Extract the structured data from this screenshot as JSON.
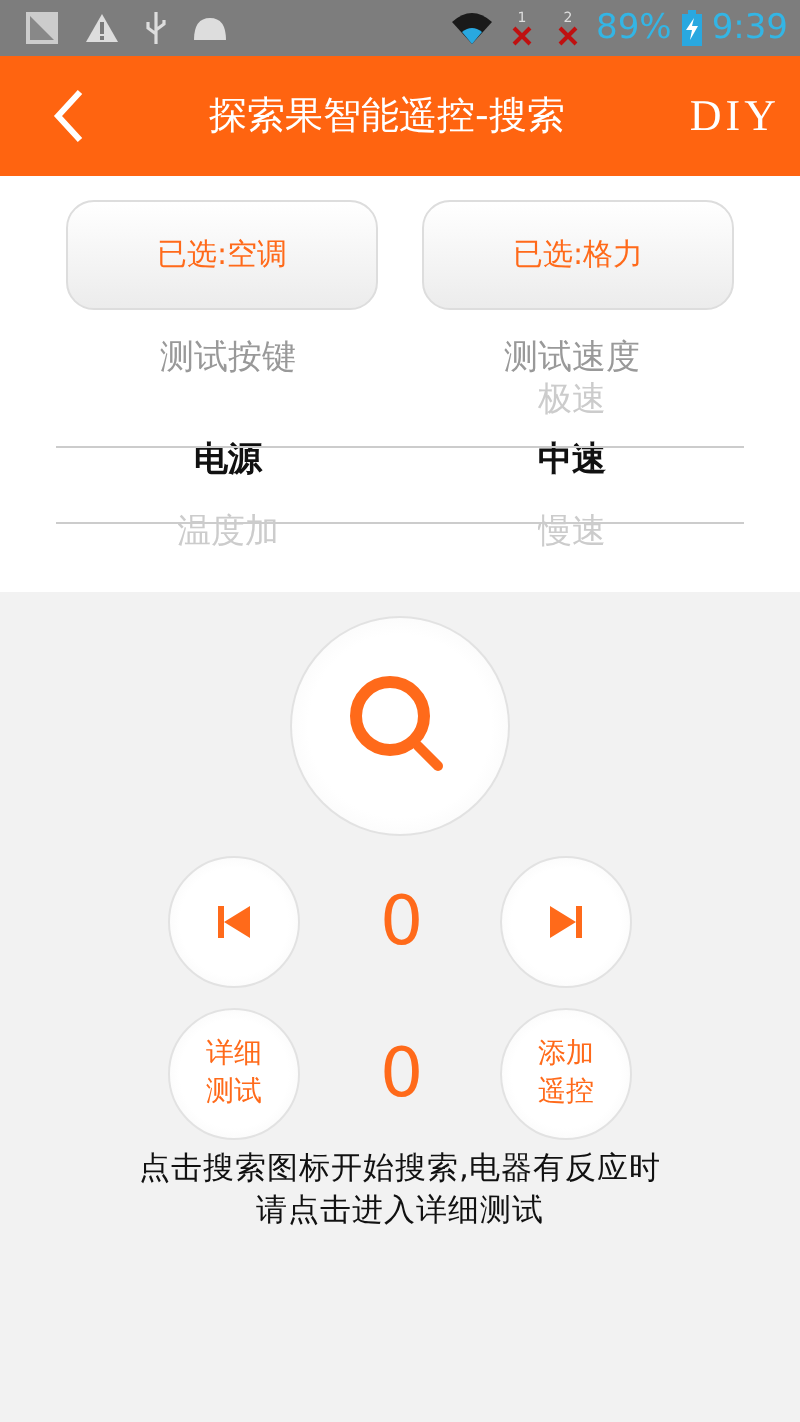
{
  "status_bar": {
    "sim1": "1",
    "sim2": "2",
    "battery": "89%",
    "time": "9:39"
  },
  "header": {
    "title": "探索果智能遥控-搜索",
    "action": "DIY"
  },
  "choices": [
    {
      "label": "已选:空调"
    },
    {
      "label": "已选:格力"
    }
  ],
  "pickers": [
    {
      "title": "测试按键",
      "items": [
        {
          "label": "电源",
          "selected": true
        },
        {
          "label": "温度加",
          "selected": false
        }
      ]
    },
    {
      "title": "测试速度",
      "items": [
        {
          "label": "极速",
          "selected": false
        },
        {
          "label": "中速",
          "selected": true
        },
        {
          "label": "慢速",
          "selected": false
        }
      ]
    }
  ],
  "counters": [
    "0",
    "0"
  ],
  "detail_button": "详细测试",
  "add_button": "添加遥控",
  "hint": "点击搜索图标开始搜索,电器有反应时请点击进入详细测试"
}
